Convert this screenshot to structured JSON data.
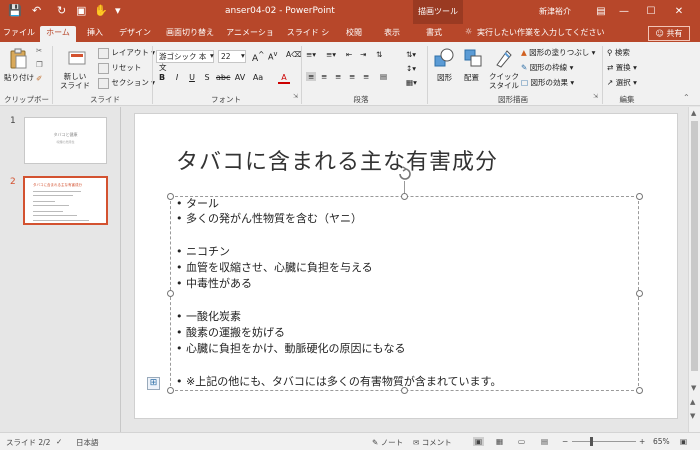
{
  "window": {
    "title": "anser04-02 - PowerPoint",
    "context_tab_group": "描画ツール",
    "user": "新津裕介"
  },
  "tabs": [
    {
      "label": "ファイル"
    },
    {
      "label": "ホーム"
    },
    {
      "label": "挿入"
    },
    {
      "label": "デザイン"
    },
    {
      "label": "画面切り替え"
    },
    {
      "label": "アニメーション"
    },
    {
      "label": "スライド ショー"
    },
    {
      "label": "校閲"
    },
    {
      "label": "表示"
    },
    {
      "label": "書式"
    }
  ],
  "tell_me": "実行したい作業を入力してください",
  "share": "共有",
  "ribbon": {
    "clipboard": {
      "paste": "貼り付け",
      "label": "クリップボード"
    },
    "slides": {
      "new_slide": "新しい スライド",
      "layout": "レイアウト",
      "reset": "リセット",
      "section": "セクション",
      "label": "スライド"
    },
    "font": {
      "font_name": "游ゴシック 本文",
      "font_size": "22",
      "label": "フォント"
    },
    "paragraph": {
      "label": "段落"
    },
    "drawing": {
      "shapes": "図形",
      "arrange": "配置",
      "quick_styles": "クイック スタイル",
      "fill": "図形の塗りつぶし",
      "outline": "図形の枠線",
      "effects": "図形の効果",
      "label": "図形描画"
    },
    "editing": {
      "find": "検索",
      "replace": "置換",
      "select": "選択",
      "label": "編集"
    }
  },
  "thumbnails": [
    {
      "number": "1",
      "title": "タバコと健康",
      "subtitle": "喫煙の危険性"
    },
    {
      "number": "2",
      "title": "タバコに含まれる主な有害成分"
    }
  ],
  "slide": {
    "title": "タバコに含まれる主な有害成分",
    "bullets": [
      "タール",
      "多くの発がん性物質を含む（ヤニ）",
      "",
      "ニコチン",
      "血管を収縮させ、心臓に負担を与える",
      "中毒性がある",
      "",
      "一酸化炭素",
      "酸素の運搬を妨げる",
      "心臓に負担をかけ、動脈硬化の原因にもなる",
      "",
      "※上記の他にも、タバコには多くの有害物質が含まれています。"
    ]
  },
  "status": {
    "slide_indicator": "スライド 2/2",
    "language": "日本語",
    "notes": "ノート",
    "comments": "コメント",
    "zoom": "65%"
  },
  "colors": {
    "accent": "#b7472a",
    "selected_thumb": "#d35230"
  }
}
